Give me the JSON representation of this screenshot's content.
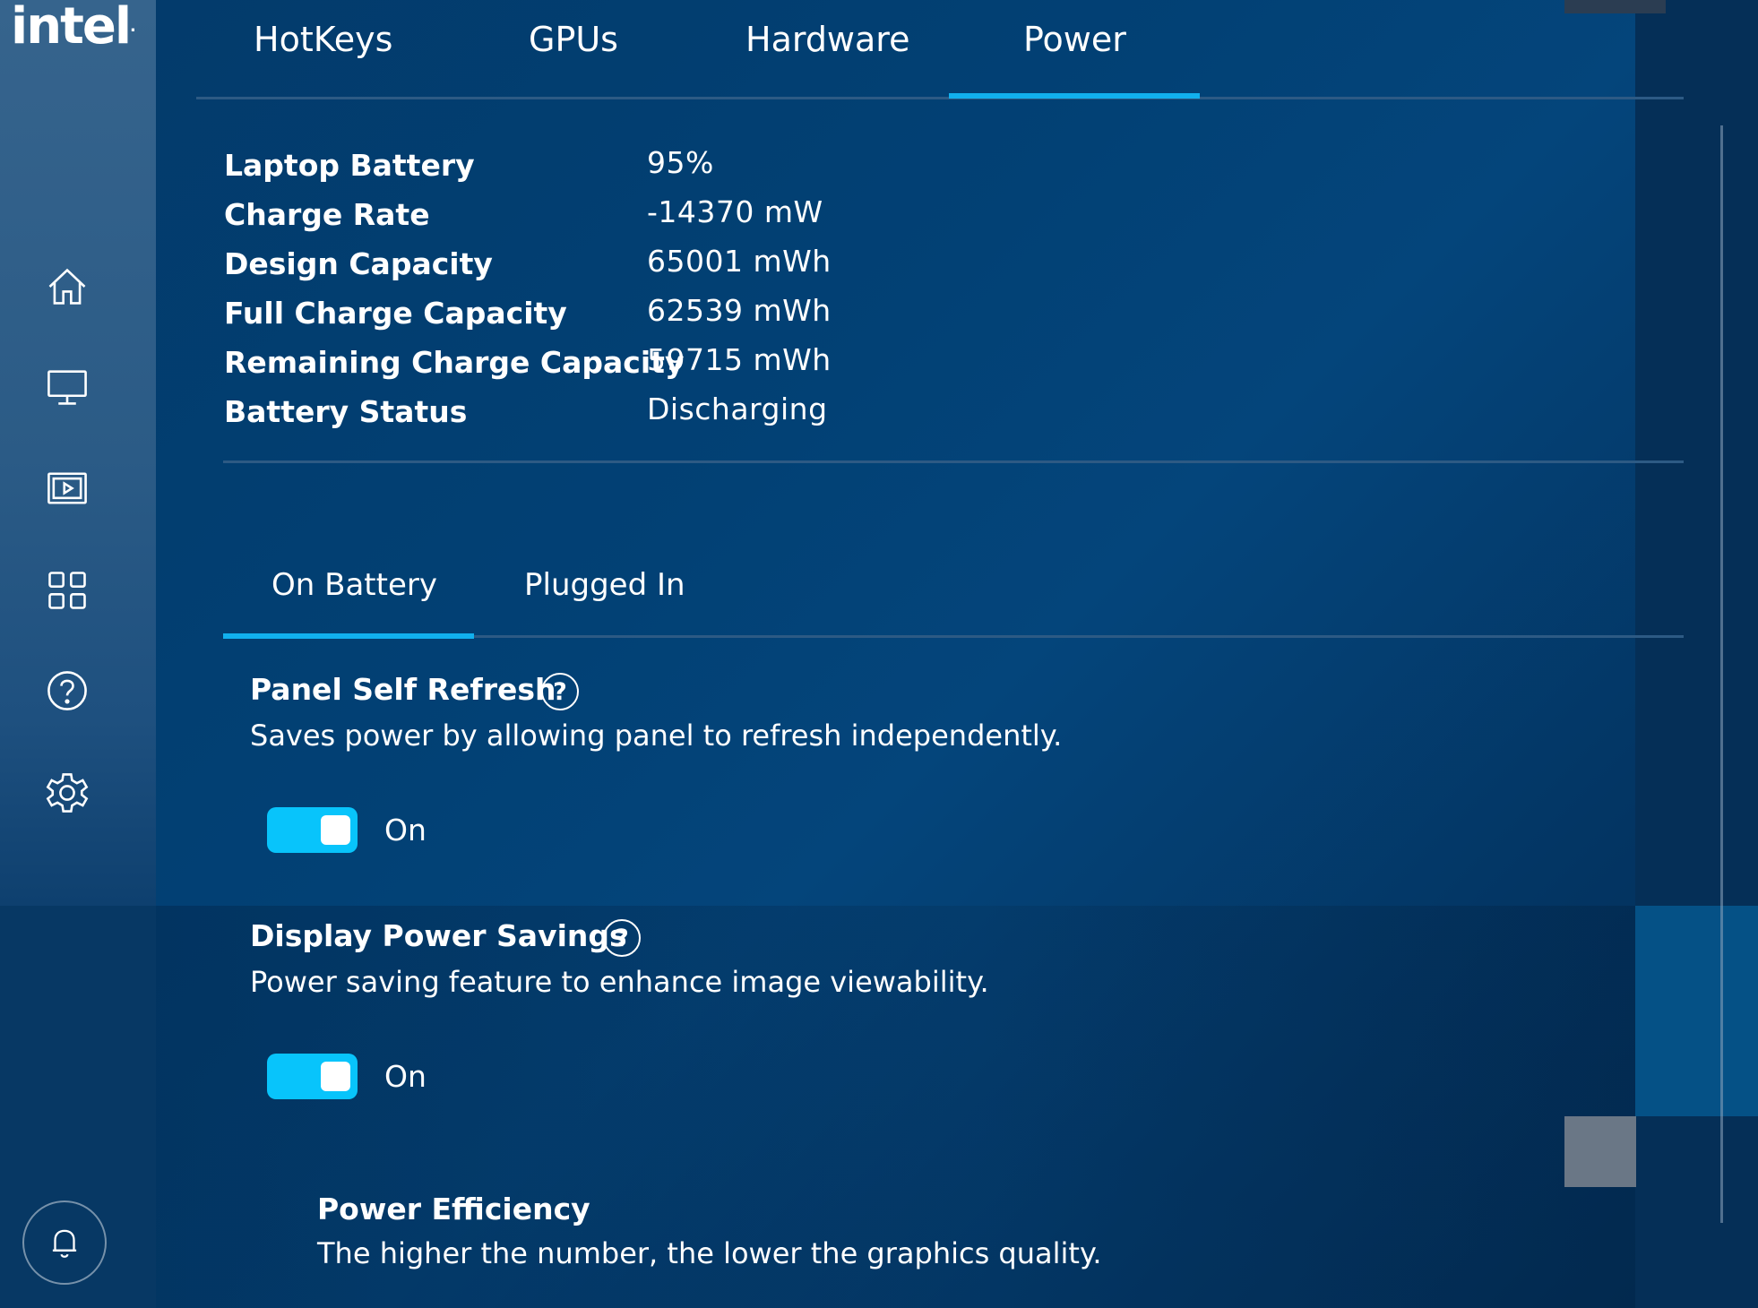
{
  "brand": {
    "logo_text": "intel",
    "logo_dot": "."
  },
  "sidebar": {
    "items": [
      {
        "name": "home",
        "icon": "home-icon"
      },
      {
        "name": "display",
        "icon": "monitor-icon"
      },
      {
        "name": "video",
        "icon": "video-icon"
      },
      {
        "name": "apps",
        "icon": "grid-icon"
      },
      {
        "name": "help",
        "icon": "help-icon"
      },
      {
        "name": "settings",
        "icon": "gear-icon"
      }
    ],
    "notifications_icon": "bell-icon"
  },
  "top_tabs": [
    {
      "label": "HotKeys",
      "active": false
    },
    {
      "label": "GPUs",
      "active": false
    },
    {
      "label": "Hardware",
      "active": false
    },
    {
      "label": "Power",
      "active": true
    }
  ],
  "battery_info": [
    {
      "label": "Laptop Battery",
      "value": "95%"
    },
    {
      "label": "Charge Rate",
      "value": "-14370 mW"
    },
    {
      "label": "Design Capacity",
      "value": "65001 mWh"
    },
    {
      "label": "Full Charge Capacity",
      "value": "62539 mWh"
    },
    {
      "label": "Remaining Charge Capacity",
      "value": "59715 mWh"
    },
    {
      "label": "Battery Status",
      "value": "Discharging"
    }
  ],
  "sub_tabs": [
    {
      "label": "On Battery",
      "active": true
    },
    {
      "label": "Plugged In",
      "active": false
    }
  ],
  "settings": {
    "panel_self_refresh": {
      "title": "Panel Self Refresh",
      "description": "Saves power by allowing panel to refresh independently.",
      "help_glyph": "?",
      "state": "On",
      "enabled": true
    },
    "display_power_savings": {
      "title": "Display Power Savings",
      "description": "Power saving feature to enhance image viewability.",
      "help_glyph": "?",
      "state": "On",
      "enabled": true
    },
    "power_efficiency": {
      "title": "Power Efficiency",
      "description": "The higher the number, the lower the graphics quality."
    }
  },
  "colors": {
    "accent": "#11b0ee",
    "toggle_on": "#08c4fb",
    "background": "#033a6a",
    "sidebar": "#2b5b86"
  }
}
